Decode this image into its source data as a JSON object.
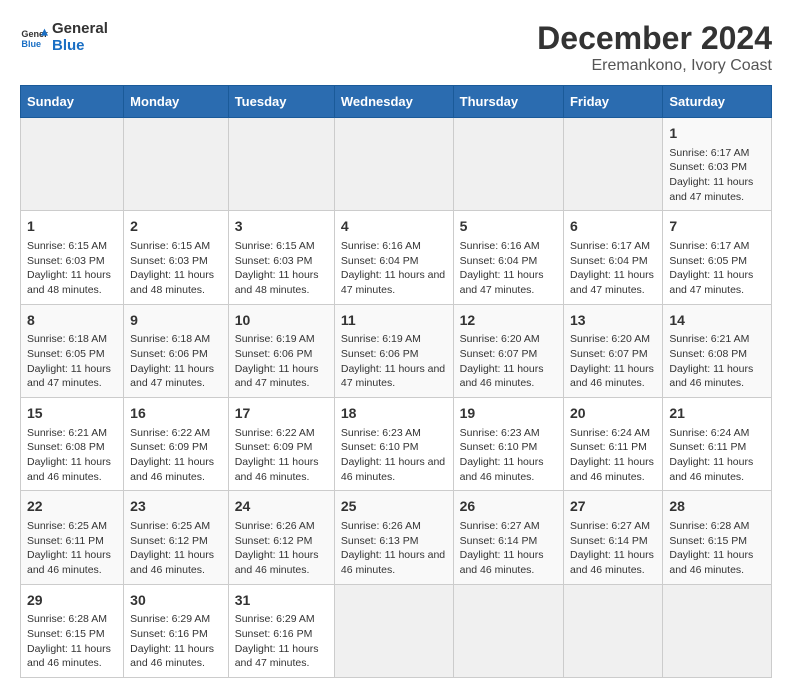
{
  "header": {
    "logo_line1": "General",
    "logo_line2": "Blue",
    "title": "December 2024",
    "subtitle": "Eremankono, Ivory Coast"
  },
  "calendar": {
    "days_of_week": [
      "Sunday",
      "Monday",
      "Tuesday",
      "Wednesday",
      "Thursday",
      "Friday",
      "Saturday"
    ],
    "weeks": [
      [
        {
          "day": "",
          "empty": true
        },
        {
          "day": "",
          "empty": true
        },
        {
          "day": "",
          "empty": true
        },
        {
          "day": "",
          "empty": true
        },
        {
          "day": "",
          "empty": true
        },
        {
          "day": "",
          "empty": true
        },
        {
          "day": "1",
          "sunrise": "Sunrise: 6:17 AM",
          "sunset": "Sunset: 6:03 PM",
          "daylight": "Daylight: 11 hours and 47 minutes."
        }
      ],
      [
        {
          "day": "1",
          "sunrise": "Sunrise: 6:15 AM",
          "sunset": "Sunset: 6:03 PM",
          "daylight": "Daylight: 11 hours and 48 minutes."
        },
        {
          "day": "2",
          "sunrise": "Sunrise: 6:15 AM",
          "sunset": "Sunset: 6:03 PM",
          "daylight": "Daylight: 11 hours and 48 minutes."
        },
        {
          "day": "3",
          "sunrise": "Sunrise: 6:15 AM",
          "sunset": "Sunset: 6:03 PM",
          "daylight": "Daylight: 11 hours and 48 minutes."
        },
        {
          "day": "4",
          "sunrise": "Sunrise: 6:16 AM",
          "sunset": "Sunset: 6:04 PM",
          "daylight": "Daylight: 11 hours and 47 minutes."
        },
        {
          "day": "5",
          "sunrise": "Sunrise: 6:16 AM",
          "sunset": "Sunset: 6:04 PM",
          "daylight": "Daylight: 11 hours and 47 minutes."
        },
        {
          "day": "6",
          "sunrise": "Sunrise: 6:17 AM",
          "sunset": "Sunset: 6:04 PM",
          "daylight": "Daylight: 11 hours and 47 minutes."
        },
        {
          "day": "7",
          "sunrise": "Sunrise: 6:17 AM",
          "sunset": "Sunset: 6:05 PM",
          "daylight": "Daylight: 11 hours and 47 minutes."
        }
      ],
      [
        {
          "day": "8",
          "sunrise": "Sunrise: 6:18 AM",
          "sunset": "Sunset: 6:05 PM",
          "daylight": "Daylight: 11 hours and 47 minutes."
        },
        {
          "day": "9",
          "sunrise": "Sunrise: 6:18 AM",
          "sunset": "Sunset: 6:06 PM",
          "daylight": "Daylight: 11 hours and 47 minutes."
        },
        {
          "day": "10",
          "sunrise": "Sunrise: 6:19 AM",
          "sunset": "Sunset: 6:06 PM",
          "daylight": "Daylight: 11 hours and 47 minutes."
        },
        {
          "day": "11",
          "sunrise": "Sunrise: 6:19 AM",
          "sunset": "Sunset: 6:06 PM",
          "daylight": "Daylight: 11 hours and 47 minutes."
        },
        {
          "day": "12",
          "sunrise": "Sunrise: 6:20 AM",
          "sunset": "Sunset: 6:07 PM",
          "daylight": "Daylight: 11 hours and 46 minutes."
        },
        {
          "day": "13",
          "sunrise": "Sunrise: 6:20 AM",
          "sunset": "Sunset: 6:07 PM",
          "daylight": "Daylight: 11 hours and 46 minutes."
        },
        {
          "day": "14",
          "sunrise": "Sunrise: 6:21 AM",
          "sunset": "Sunset: 6:08 PM",
          "daylight": "Daylight: 11 hours and 46 minutes."
        }
      ],
      [
        {
          "day": "15",
          "sunrise": "Sunrise: 6:21 AM",
          "sunset": "Sunset: 6:08 PM",
          "daylight": "Daylight: 11 hours and 46 minutes."
        },
        {
          "day": "16",
          "sunrise": "Sunrise: 6:22 AM",
          "sunset": "Sunset: 6:09 PM",
          "daylight": "Daylight: 11 hours and 46 minutes."
        },
        {
          "day": "17",
          "sunrise": "Sunrise: 6:22 AM",
          "sunset": "Sunset: 6:09 PM",
          "daylight": "Daylight: 11 hours and 46 minutes."
        },
        {
          "day": "18",
          "sunrise": "Sunrise: 6:23 AM",
          "sunset": "Sunset: 6:10 PM",
          "daylight": "Daylight: 11 hours and 46 minutes."
        },
        {
          "day": "19",
          "sunrise": "Sunrise: 6:23 AM",
          "sunset": "Sunset: 6:10 PM",
          "daylight": "Daylight: 11 hours and 46 minutes."
        },
        {
          "day": "20",
          "sunrise": "Sunrise: 6:24 AM",
          "sunset": "Sunset: 6:11 PM",
          "daylight": "Daylight: 11 hours and 46 minutes."
        },
        {
          "day": "21",
          "sunrise": "Sunrise: 6:24 AM",
          "sunset": "Sunset: 6:11 PM",
          "daylight": "Daylight: 11 hours and 46 minutes."
        }
      ],
      [
        {
          "day": "22",
          "sunrise": "Sunrise: 6:25 AM",
          "sunset": "Sunset: 6:11 PM",
          "daylight": "Daylight: 11 hours and 46 minutes."
        },
        {
          "day": "23",
          "sunrise": "Sunrise: 6:25 AM",
          "sunset": "Sunset: 6:12 PM",
          "daylight": "Daylight: 11 hours and 46 minutes."
        },
        {
          "day": "24",
          "sunrise": "Sunrise: 6:26 AM",
          "sunset": "Sunset: 6:12 PM",
          "daylight": "Daylight: 11 hours and 46 minutes."
        },
        {
          "day": "25",
          "sunrise": "Sunrise: 6:26 AM",
          "sunset": "Sunset: 6:13 PM",
          "daylight": "Daylight: 11 hours and 46 minutes."
        },
        {
          "day": "26",
          "sunrise": "Sunrise: 6:27 AM",
          "sunset": "Sunset: 6:14 PM",
          "daylight": "Daylight: 11 hours and 46 minutes."
        },
        {
          "day": "27",
          "sunrise": "Sunrise: 6:27 AM",
          "sunset": "Sunset: 6:14 PM",
          "daylight": "Daylight: 11 hours and 46 minutes."
        },
        {
          "day": "28",
          "sunrise": "Sunrise: 6:28 AM",
          "sunset": "Sunset: 6:15 PM",
          "daylight": "Daylight: 11 hours and 46 minutes."
        }
      ],
      [
        {
          "day": "29",
          "sunrise": "Sunrise: 6:28 AM",
          "sunset": "Sunset: 6:15 PM",
          "daylight": "Daylight: 11 hours and 46 minutes."
        },
        {
          "day": "30",
          "sunrise": "Sunrise: 6:29 AM",
          "sunset": "Sunset: 6:16 PM",
          "daylight": "Daylight: 11 hours and 46 minutes."
        },
        {
          "day": "31",
          "sunrise": "Sunrise: 6:29 AM",
          "sunset": "Sunset: 6:16 PM",
          "daylight": "Daylight: 11 hours and 47 minutes."
        },
        {
          "day": "",
          "empty": true
        },
        {
          "day": "",
          "empty": true
        },
        {
          "day": "",
          "empty": true
        },
        {
          "day": "",
          "empty": true
        }
      ]
    ]
  }
}
